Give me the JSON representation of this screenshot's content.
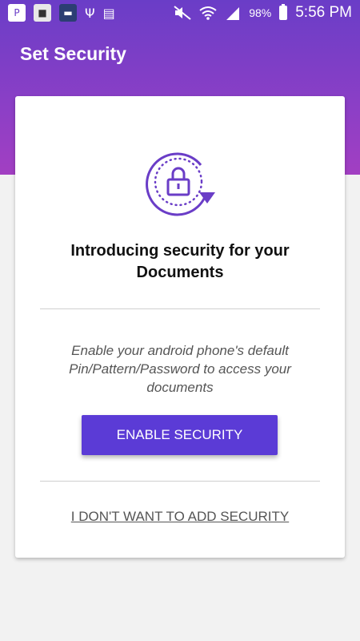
{
  "status_bar": {
    "battery_percent": "98%",
    "battery_level": 0.98,
    "time": "5:56 PM",
    "notification_icons": [
      "app-p-icon",
      "bank-icon",
      "card-icon",
      "usb-icon",
      "sim-icon"
    ],
    "system_icons": [
      "mute-icon",
      "wifi-icon",
      "signal-icon",
      "battery-icon"
    ]
  },
  "header": {
    "title": "Set Security",
    "gradient": [
      "#6a3dc7",
      "#a23fc2"
    ]
  },
  "card": {
    "icon": "security-lock-icon",
    "title": "Introducing security for your Documents",
    "description": "Enable your android phone's default Pin/Pattern/Password to access your documents",
    "enable_button_label": "ENABLE SECURITY",
    "skip_link_label": "I DON'T WANT TO ADD SECURITY"
  },
  "colors": {
    "accent": "#5b3bd6",
    "icon": "#6a3dc7"
  }
}
